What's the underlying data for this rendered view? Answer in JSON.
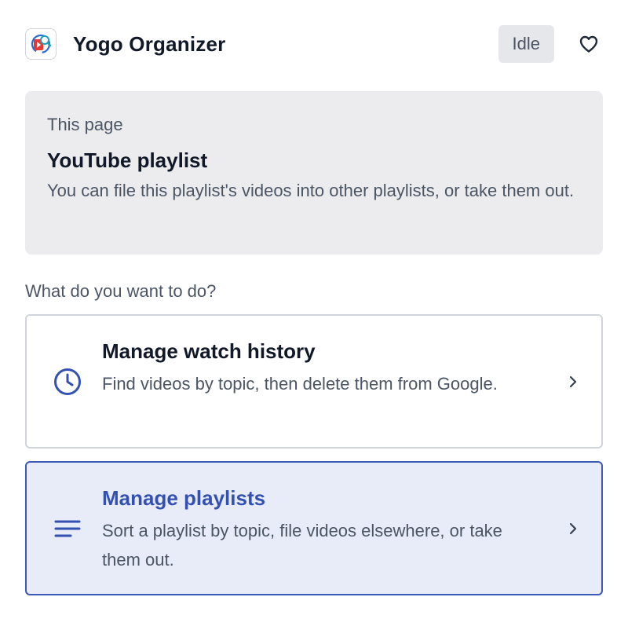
{
  "header": {
    "app_name": "Yogo Organizer",
    "status": "Idle",
    "logo_icon": "yogo-logo-icon",
    "favorite_icon": "heart-icon"
  },
  "context": {
    "eyebrow": "This page",
    "title": "YouTube playlist",
    "description": "You can file this playlist's videos into other playlists, or take them out."
  },
  "prompt": "What do you want to do?",
  "options": [
    {
      "title": "Manage watch history",
      "description": "Find videos by topic, then delete them from Google.",
      "icon": "clock-icon",
      "selected": false
    },
    {
      "title": "Manage playlists",
      "description": "Sort a playlist by topic, file videos elsewhere, or take them out.",
      "icon": "list-icon",
      "selected": true
    }
  ],
  "colors": {
    "accent": "#3451b2",
    "selected_bg": "#e8ecf8",
    "card_bg": "#ececef",
    "badge_bg": "#e5e7eb"
  }
}
